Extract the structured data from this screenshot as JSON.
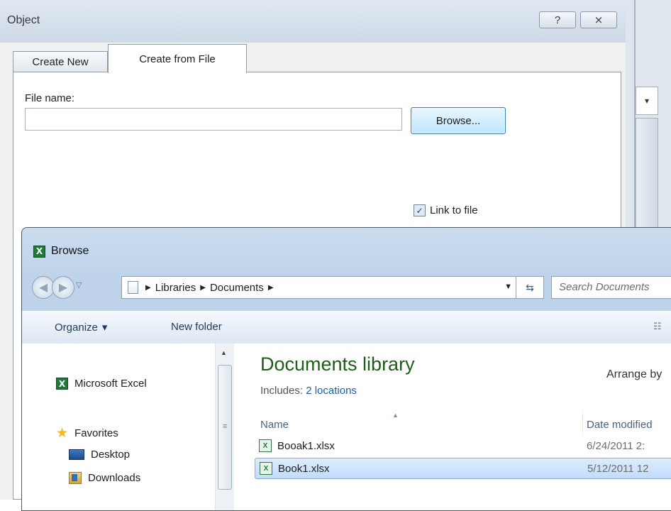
{
  "object_dialog": {
    "title": "Object",
    "help_glyph": "?",
    "close_glyph": "⨯",
    "tabs": [
      {
        "label": "Create New"
      },
      {
        "label": "Create from File"
      }
    ],
    "file_name_label": "File name:",
    "file_name_value": "",
    "browse_button": "Browse...",
    "link_to_file_label": "Link to file",
    "link_to_file_checked": true
  },
  "browse_dialog": {
    "title": "Browse",
    "breadcrumb": [
      "Libraries",
      "Documents"
    ],
    "search_placeholder": "Search Documents",
    "toolbar": {
      "organize_label": "Organize",
      "new_folder_label": "New folder"
    },
    "nav_pane": {
      "items": [
        {
          "label": "Microsoft Excel",
          "icon": "excel-icon"
        },
        {
          "label": "Favorites",
          "icon": "star-icon"
        },
        {
          "label": "Desktop",
          "icon": "desktop-icon"
        },
        {
          "label": "Downloads",
          "icon": "downloads-icon"
        }
      ]
    },
    "library": {
      "title": "Documents library",
      "includes_label": "Includes:",
      "includes_link": "2 locations",
      "arrange_label": "Arrange by"
    },
    "columns": {
      "name": "Name",
      "date": "Date modified"
    },
    "files": [
      {
        "name": "Booak1.xlsx",
        "date": "6/24/2011 2:",
        "selected": false
      },
      {
        "name": "Book1.xlsx",
        "date": "5/12/2011 12",
        "selected": true
      }
    ]
  },
  "colors": {
    "accent_green": "#1e5d18",
    "link_blue": "#1b5fb0",
    "selection_bg": "#c2dcfd"
  }
}
